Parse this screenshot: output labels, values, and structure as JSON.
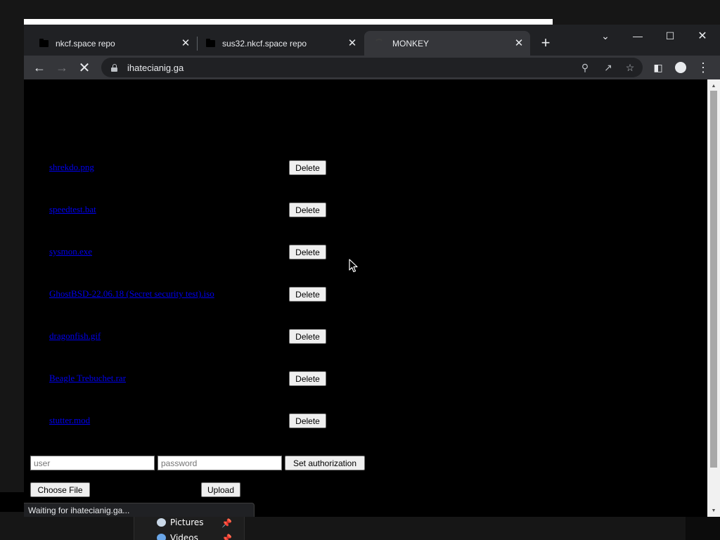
{
  "tabs": [
    {
      "title": "nkcf.space repo",
      "icon": "folder-icon",
      "active": false
    },
    {
      "title": "sus32.nkcf.space repo",
      "icon": "folder-icon",
      "active": false
    },
    {
      "title": "MONKEY",
      "icon": "loading-spinner-icon",
      "active": true
    }
  ],
  "toolbar": {
    "url": "ihatecianig.ga"
  },
  "files": [
    {
      "name": "shrekdo.png",
      "delete_label": "Delete"
    },
    {
      "name": "speedtest.bat",
      "delete_label": "Delete"
    },
    {
      "name": "sysmon.exe",
      "delete_label": "Delete"
    },
    {
      "name": "GhostBSD-22.06.18 (Secret security test).iso",
      "delete_label": "Delete"
    },
    {
      "name": "dragonfish.gif",
      "delete_label": "Delete"
    },
    {
      "name": "Beagle Trebuchet.rar",
      "delete_label": "Delete"
    },
    {
      "name": "stutter.mod",
      "delete_label": "Delete"
    }
  ],
  "auth_form": {
    "user_placeholder": "user",
    "password_placeholder": "password",
    "set_auth_label": "Set authorization"
  },
  "upload_form": {
    "choose_file_label": "Choose File",
    "upload_label": "Upload"
  },
  "status": "Waiting for ihatecianig.ga...",
  "explorer": {
    "items": [
      {
        "label": "Pictures"
      },
      {
        "label": "Videos"
      }
    ]
  },
  "colors": {
    "link": "#0000ee",
    "page_background": "#000000",
    "browser_frame": "#202124",
    "toolbar": "#35363a"
  }
}
